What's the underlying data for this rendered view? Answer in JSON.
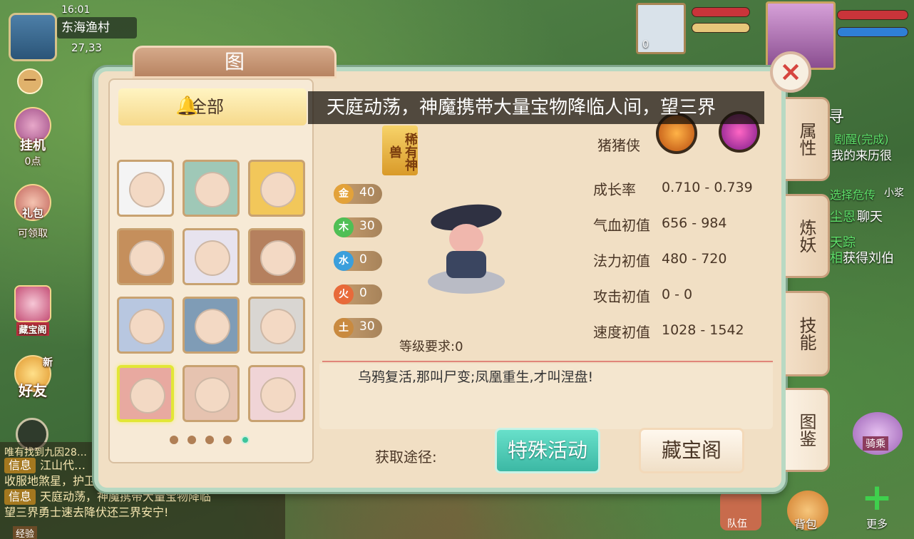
{
  "hud": {
    "time": "16:01",
    "location": "东海渔村",
    "coords": "27,33",
    "pet_level": "0",
    "hang_label": "挂机",
    "hang_points": "0点",
    "gift_label": "礼包",
    "gift_status": "可领取",
    "treasure_label": "藏宝阁",
    "friends_label": "好友",
    "friends_badge": "新",
    "exp_label": "经验",
    "team_label": "队伍",
    "bag_label": "背包",
    "more_label": "更多",
    "mount_label": "骑乘"
  },
  "chat": {
    "lines": [
      {
        "tag": "",
        "text": "唯有找到九因28…"
      },
      {
        "tag": "信息",
        "text": "江山代…"
      },
      {
        "tag": "",
        "text": "收服地煞星，护卫三界安宁。"
      },
      {
        "tag": "信息",
        "text": "天庭动荡，神魔携带大量宝物降临"
      },
      {
        "tag": "",
        "text": "望三界勇士速去降伏还三界安宁!"
      }
    ]
  },
  "right_hud_text": [
    "寻",
    "剧醒(完成)",
    "我的来历很",
    "选择危传",
    "小浆",
    "尘恩",
    "聊天",
    "天踪",
    "相",
    "获得刘伯"
  ],
  "panel": {
    "title": "图 鉴",
    "filter_label": "全部",
    "banner": "天庭动荡，神魔携带大量宝物降临人间，望三界",
    "rarity_tag": "稀有神兽",
    "pet_name": "猪猪侠",
    "skills": [
      "fist-fire-skill-icon",
      "skull-skill-icon"
    ],
    "stats": [
      {
        "label": "成长率",
        "value": "0.710 - 0.739"
      },
      {
        "label": "气血初值",
        "value": "656 - 984"
      },
      {
        "label": "法力初值",
        "value": "480 - 720"
      },
      {
        "label": "攻击初值",
        "value": "0 - 0"
      },
      {
        "label": "速度初值",
        "value": "1028 - 1542"
      }
    ],
    "elements": [
      {
        "glyph": "金",
        "value": "40",
        "color": "#e3a23a"
      },
      {
        "glyph": "木",
        "value": "30",
        "color": "#4fbf55"
      },
      {
        "glyph": "水",
        "value": "0",
        "color": "#3b9fdc"
      },
      {
        "glyph": "火",
        "value": "0",
        "color": "#e86a3a"
      },
      {
        "glyph": "土",
        "value": "30",
        "color": "#c98a3f"
      }
    ],
    "level_req": "等级要求:0",
    "description": "乌鸦复活,那叫尸变;凤凰重生,才叫涅盘!",
    "source_label": "获取途径:",
    "source_buttons": [
      "特殊活动",
      "藏宝阁"
    ],
    "tabs": [
      {
        "label": "属性",
        "active": false
      },
      {
        "label": "炼妖",
        "active": false
      },
      {
        "label": "技能",
        "active": false
      },
      {
        "label": "图鉴",
        "active": true
      }
    ],
    "page_count": 5,
    "page_index": 5,
    "selected_cell": 9,
    "cells": [
      {
        "name": "panda-portrait",
        "color": "#f4f4f4"
      },
      {
        "name": "green-ghost-portrait",
        "color": "#9fc8b7"
      },
      {
        "name": "blonde-girl-portrait",
        "color": "#f2c75a"
      },
      {
        "name": "bearded-man-portrait",
        "color": "#c58f5c"
      },
      {
        "name": "white-hair-girl-portrait",
        "color": "#e7e3ee"
      },
      {
        "name": "dark-hair-man-portrait",
        "color": "#b5805e"
      },
      {
        "name": "silver-elf-portrait",
        "color": "#b8c7e0"
      },
      {
        "name": "armored-knight-portrait",
        "color": "#7f9cb6"
      },
      {
        "name": "white-sage-portrait",
        "color": "#d9d6d2"
      },
      {
        "name": "pig-hero-portrait",
        "color": "#e8a9a0"
      },
      {
        "name": "princess-portrait",
        "color": "#e6c3b0"
      },
      {
        "name": "pink-maiden-portrait",
        "color": "#f0d4d6"
      }
    ]
  }
}
